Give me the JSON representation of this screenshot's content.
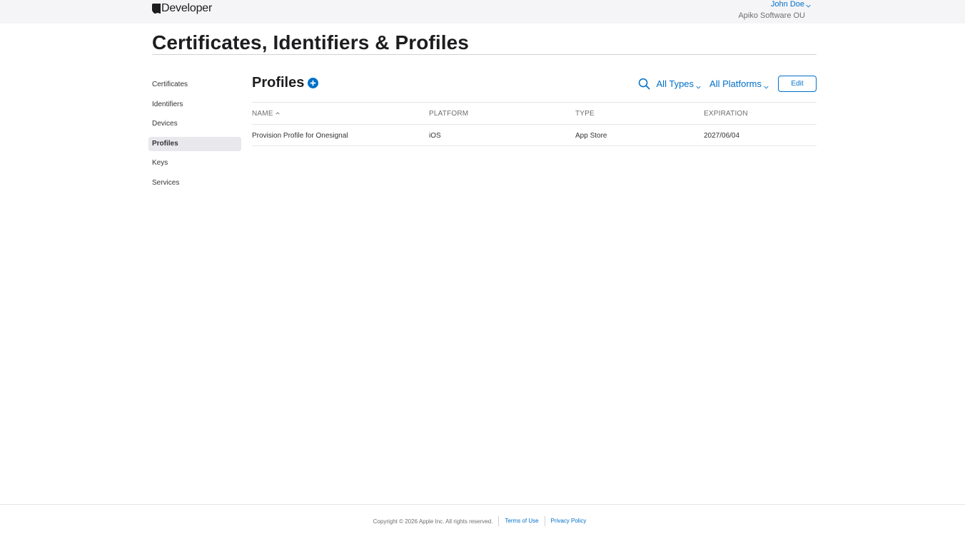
{
  "globalnav": {
    "brand_text": "Developer",
    "brand_icon": "apple-logo-icon",
    "account_name": "John Doe",
    "team_name": "Apiko Software OU"
  },
  "page": {
    "title": "Certificates, Identifiers & Profiles"
  },
  "sidebar": {
    "items": [
      {
        "label": "Certificates",
        "active": false
      },
      {
        "label": "Identifiers",
        "active": false
      },
      {
        "label": "Devices",
        "active": false
      },
      {
        "label": "Profiles",
        "active": true
      },
      {
        "label": "Keys",
        "active": false
      },
      {
        "label": "Services",
        "active": false
      }
    ]
  },
  "section": {
    "title": "Profiles",
    "add_icon": "plus-circle-icon"
  },
  "toolbar": {
    "search_icon": "search-icon",
    "type_filter": "All Types",
    "platform_filter": "All Platforms",
    "edit_label": "Edit"
  },
  "table": {
    "columns": [
      "NAME",
      "PLATFORM",
      "TYPE",
      "EXPIRATION"
    ],
    "sort_column": "NAME",
    "sort_direction": "ascending",
    "rows": [
      {
        "name": "Provision Profile for Onesignal",
        "platform": "iOS",
        "type": "App Store",
        "expiration": "2027/06/04"
      }
    ]
  },
  "footer": {
    "copyright": "Copyright © 2026 Apple Inc. All rights reserved.",
    "links": [
      "Terms of Use",
      "Privacy Policy"
    ]
  },
  "colors": {
    "accent": "#0070c9",
    "text": "#1d1d1f",
    "nav_background": "#f5f5f7",
    "active_sidebar": "#e8e8ed"
  }
}
